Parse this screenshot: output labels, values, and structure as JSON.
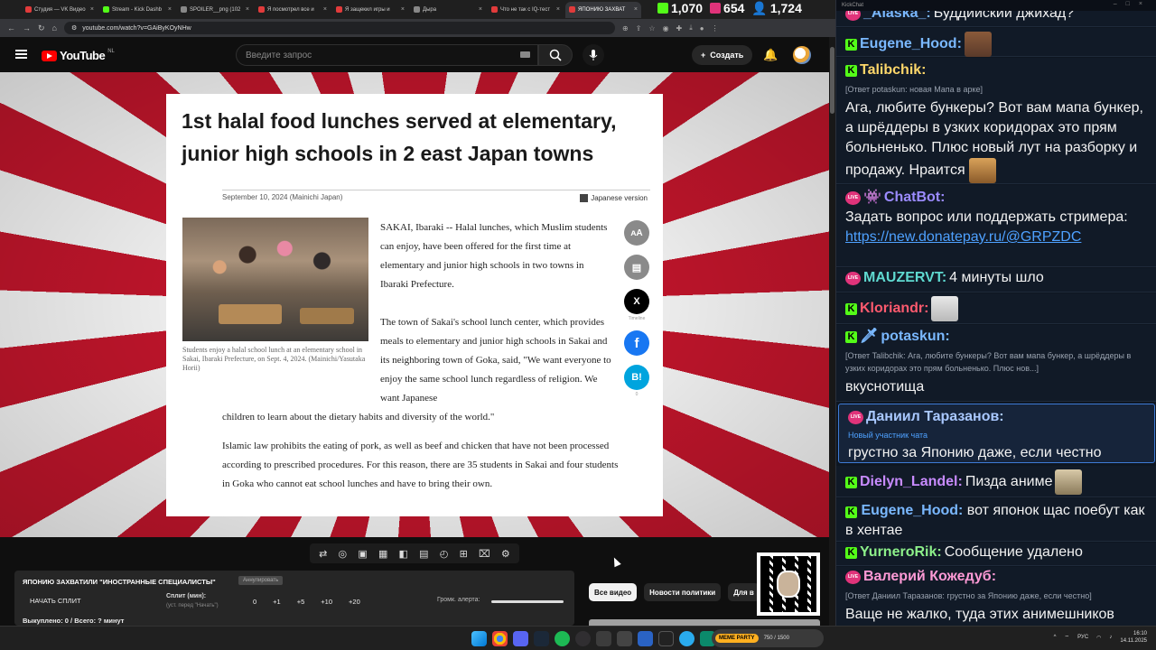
{
  "browser": {
    "tabs": [
      {
        "title": "Студия — VK Видео",
        "color": "#e13b3b"
      },
      {
        "title": "Stream - Kick Dashb",
        "color": "#53fc18"
      },
      {
        "title": "SPOILER__png (102",
        "color": "#888888"
      },
      {
        "title": "Я посмотрел все и",
        "color": "#e13b3b"
      },
      {
        "title": "Я защекил игры и",
        "color": "#e13b3b"
      },
      {
        "title": "Дыра",
        "color": "#888888"
      },
      {
        "title": "Что не так с IQ-тест",
        "color": "#e13b3b"
      },
      {
        "title": "ЯПОНИЮ ЗАХВАТ",
        "color": "#e13b3b",
        "active": true
      }
    ],
    "url": "youtube.com/watch?v=GAiByKOyNHw"
  },
  "stats": {
    "kick_viewers": "1,070",
    "vk_viewers": "654",
    "total_viewers": "1,724"
  },
  "youtube": {
    "logo_text": "YouTube",
    "country": "NL",
    "search_placeholder": "Введите запрос",
    "create_label": "Создать"
  },
  "article": {
    "headline": "1st halal food lunches served at elementary, junior high schools in 2 east Japan towns",
    "dateline": "September 10, 2024 (Mainichi Japan)",
    "japanese_version": "Japanese version",
    "caption": "Students enjoy a halal school lunch at an elementary school in Sakai, Ibaraki Prefecture, on Sept. 4, 2024. (Mainichi/Yasutaka Horii)",
    "para1": "SAKAI, Ibaraki -- Halal lunches, which Muslim students can enjoy, have been offered for the first time at elementary and junior high schools in two towns in Ibaraki Prefecture.",
    "para2a": "The town of Sakai's school lunch center, which provides meals to elementary and junior high schools in Sakai and its neighboring town of Goka, said, \"We want everyone to enjoy the same school lunch regardless of religion. We want Japanese",
    "para2b": "children to learn about the dietary habits and diversity of the world.\"",
    "para3": "Islamic law prohibits the eating of pork, as well as beef and chicken that have not been processed according to prescribed procedures. For this reason, there are 35 students in Sakai and four students in Goka who cannot eat school lunches and have to bring their own.",
    "share": {
      "font": "ᴀA",
      "x": "X",
      "x_label": "Timeline",
      "facebook": "f",
      "hatena": "B!",
      "hatena_count": "0"
    }
  },
  "split_panel": {
    "title": "ЯПОНИЮ ЗАХВАТИЛИ \"ИНОСТРАННЫЕ СПЕЦИАЛИСТЫ\"",
    "badge": "Аннулировать",
    "start": "НАЧАТЬ СПЛИТ",
    "split_label": "Сплит (мин):",
    "split_hint": "(уст. перед \"Начать\")",
    "values": [
      "0",
      "+1",
      "+5",
      "+10",
      "+20"
    ],
    "alert_label": "Громк. алерта:",
    "done": "Выкуплено: 0 / Всего: ? минут"
  },
  "filters": [
    "Все видео",
    "Новости политики",
    "Для в"
  ],
  "chat": {
    "title": "KickChat",
    "messages": [
      {
        "user": "_Alaska_:",
        "color": "#7ab8ff",
        "badge": "live",
        "text": "Буддийский джихад?"
      },
      {
        "user": "Eugene_Hood:",
        "color": "#7ab8ff",
        "badge": "kick",
        "text": ""
      },
      {
        "user": "Talibchik:",
        "color": "#ffd76a",
        "badge": "kick",
        "reply": "[Ответ potaskun: новая Мапа в арке]",
        "text": "Ага, любите бункеры? Вот вам мапа бункер, а шрёддеры в узких коридорах это прям больненько. Плюс новый лут на разборку и продажу. Нраится"
      },
      {
        "user": "ChatBot:",
        "color": "#9b8bff",
        "badge": "live",
        "text": "Задать вопрос или поддержать стримера:",
        "link": "https://new.donatepay.ru/@GRPZDC"
      },
      {
        "user": "MAUZERVT:",
        "color": "#5fd9d0",
        "badge": "live",
        "text": "4 минуты шло"
      },
      {
        "user": "Kloriandr:",
        "color": "#ff5a6e",
        "badge": "kick",
        "text": ""
      },
      {
        "user": "potaskun:",
        "color": "#7ab8ff",
        "badge": "kick",
        "reply": "[Ответ Talibchik: Ага, любите бункеры? Вот вам мапа бункер, а шрёддеры в узких коридорах это прям больненько. Плюс нов...]",
        "text": "вкуснотища"
      },
      {
        "user": "Даниил Таразанов:",
        "color": "#a9c8ff",
        "badge": "live",
        "newbie": "Новый участник чата",
        "text": "грустно за Японию даже, если честно"
      },
      {
        "user": "Dielyn_Landel:",
        "color": "#c88bff",
        "badge": "kick",
        "text": "Пизда аниме"
      },
      {
        "user": "Eugene_Hood:",
        "color": "#7ab8ff",
        "badge": "kick",
        "text": "вот японок щас поебут как в хентае"
      },
      {
        "user": "YurneroRik:",
        "color": "#8df08a",
        "badge": "kick",
        "text": "Сообщение удалено"
      },
      {
        "user": "Валерий Кожедуб:",
        "color": "#ff9ad6",
        "badge": "live",
        "reply": "[Ответ Даниил Таразанов: грустно за Японию даже, если честно]",
        "text": "Ваще не жалко, туда этих анимешников"
      }
    ]
  },
  "taskbar": {
    "game_label": "MEME PARTY",
    "game_stat": "750 / 1500",
    "lang": "РУС",
    "time": "16:10",
    "date": "14.11.2025"
  }
}
